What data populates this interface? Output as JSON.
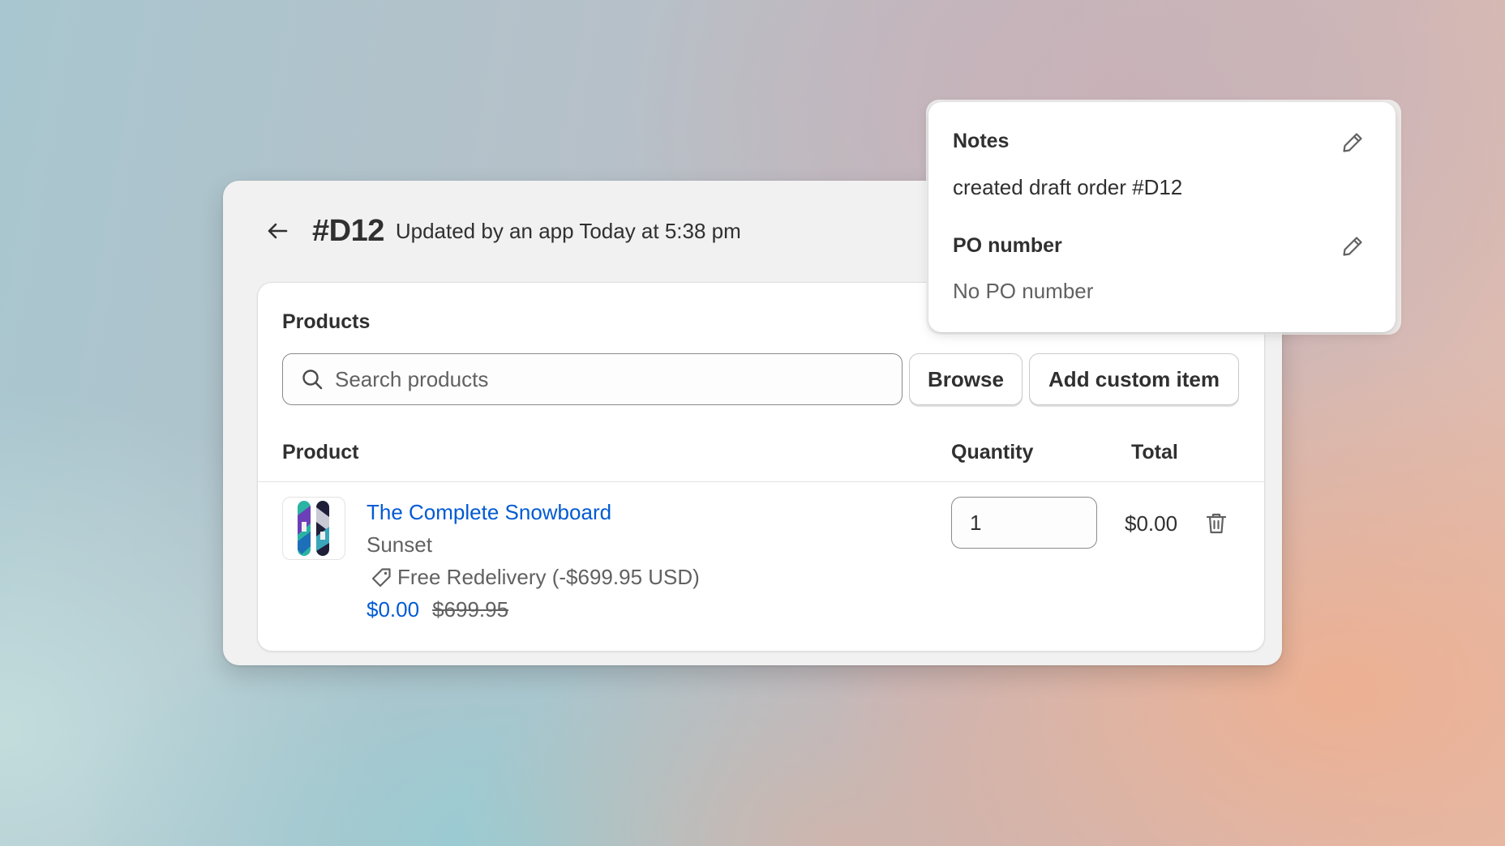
{
  "header": {
    "order_id": "#D12",
    "updated_text": "Updated by an app Today at 5:38 pm"
  },
  "products_section": {
    "title": "Products",
    "search": {
      "placeholder": "Search products",
      "value": ""
    },
    "browse_label": "Browse",
    "add_custom_label": "Add custom item",
    "columns": {
      "product": "Product",
      "quantity": "Quantity",
      "total": "Total"
    },
    "line_items": [
      {
        "name": "The Complete Snowboard",
        "variant": "Sunset",
        "discount": "Free Redelivery (-$699.95 USD)",
        "price": "$0.00",
        "original_price": "$699.95",
        "quantity": "1",
        "total": "$0.00"
      }
    ]
  },
  "notes_panel": {
    "notes_title": "Notes",
    "notes_text": "created draft order #D12",
    "po_title": "PO number",
    "po_text": "No PO number"
  },
  "icons": {
    "back": "arrow-left-icon",
    "search": "search-icon",
    "discount": "tag-icon",
    "delete": "trash-icon",
    "edit": "pencil-icon"
  },
  "colors": {
    "link": "#005bd3",
    "text": "#303030",
    "subdued": "#616161",
    "card": "#ffffff",
    "page_card": "#f1f1f1"
  }
}
